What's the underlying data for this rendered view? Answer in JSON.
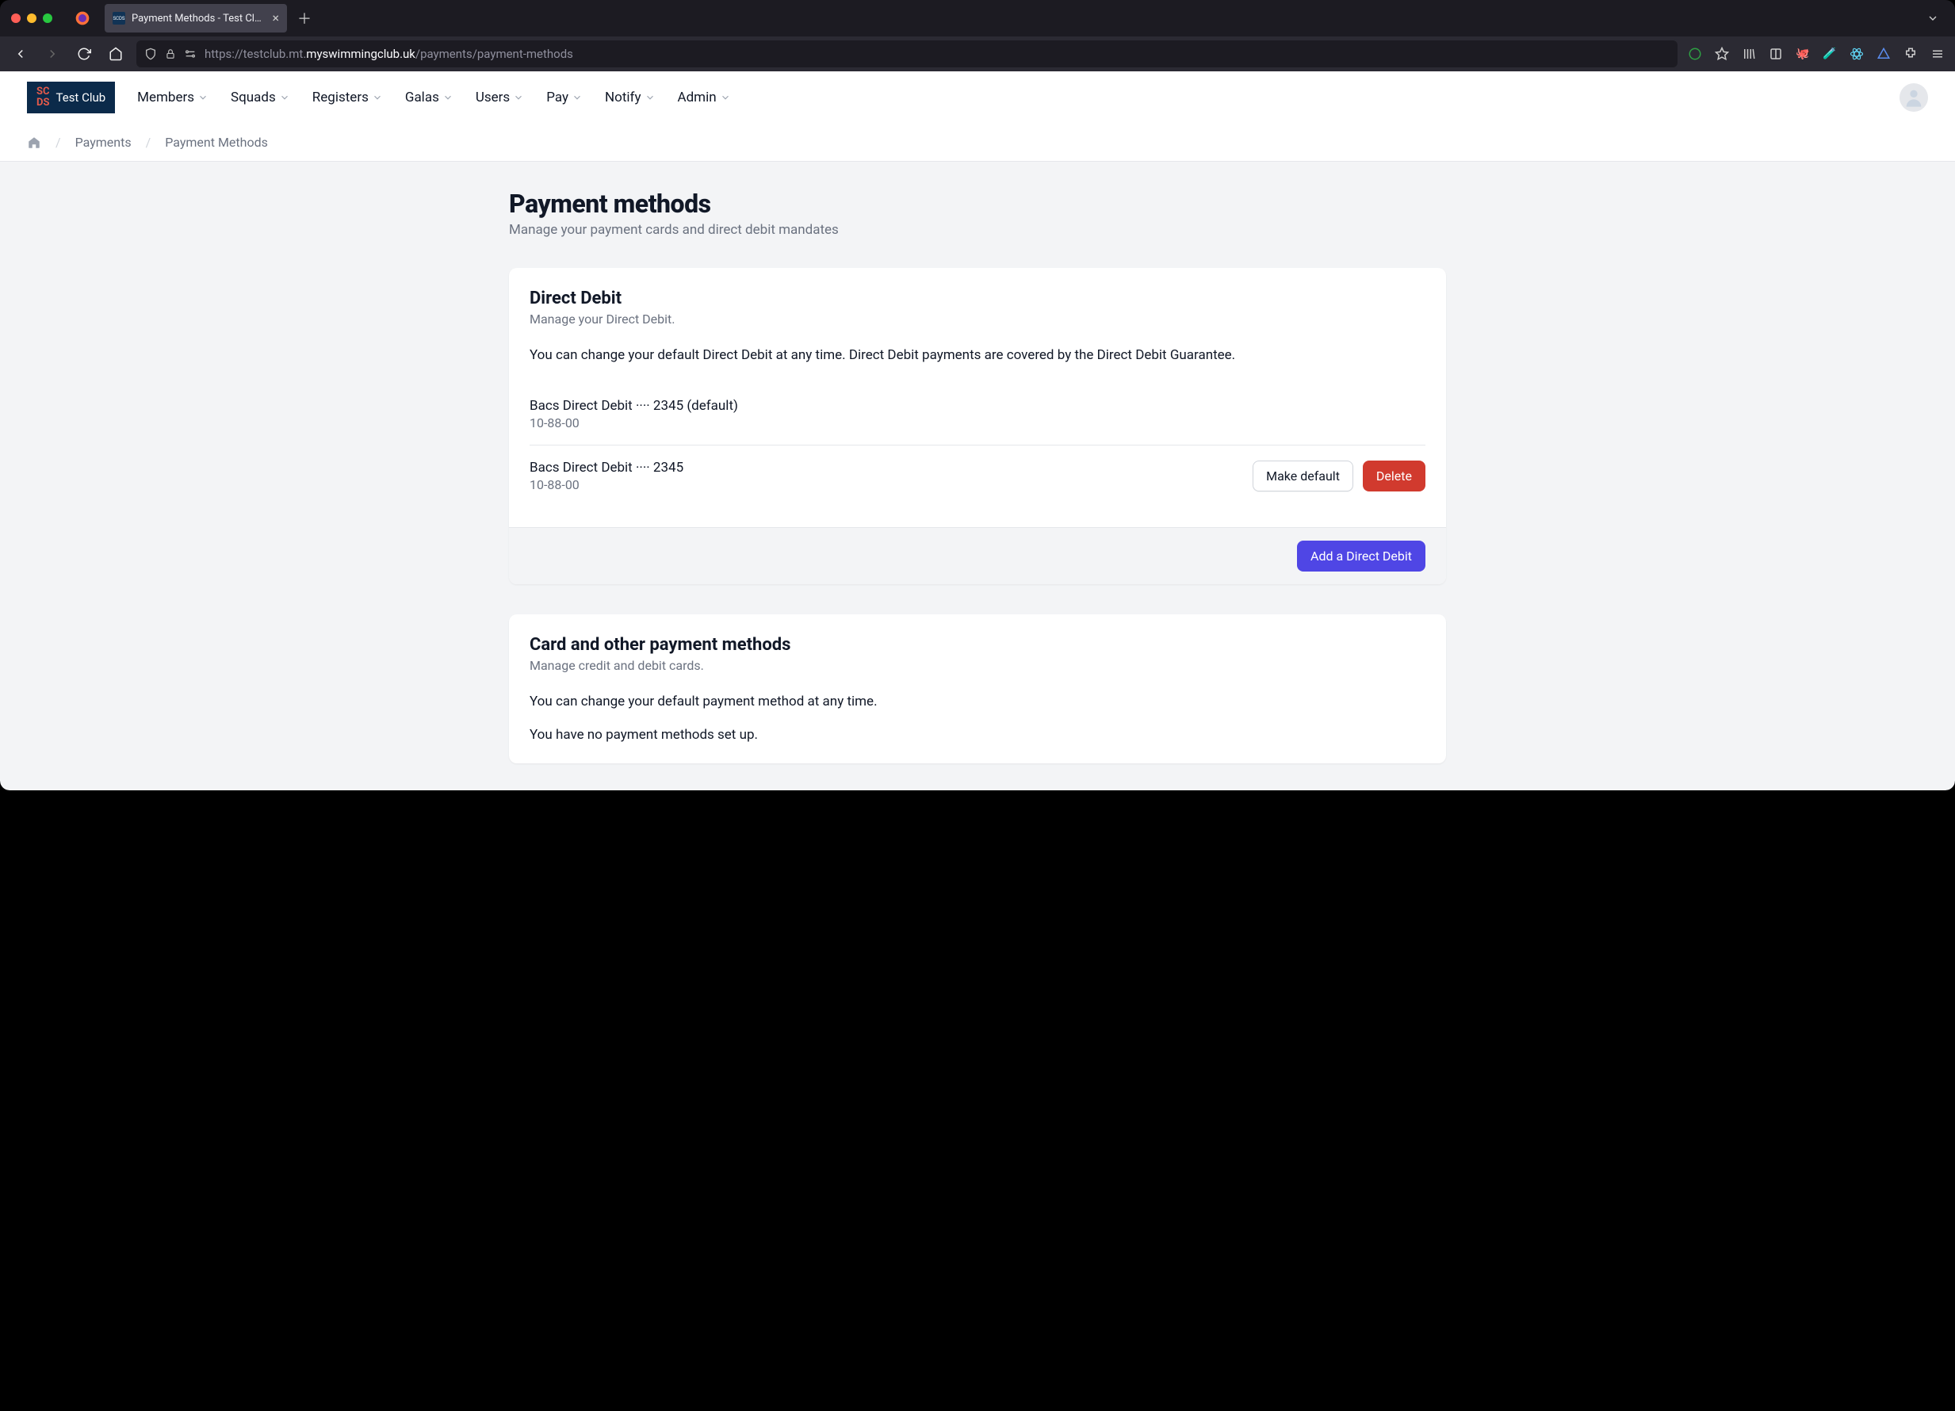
{
  "browser": {
    "tab_title": "Payment Methods - Test Club M",
    "url_prefix": "https://testclub.mt.",
    "url_domain": "myswimmingclub.uk",
    "url_path": "/payments/payment-methods"
  },
  "brand": {
    "name": "Test Club"
  },
  "nav": {
    "items": [
      {
        "label": "Members"
      },
      {
        "label": "Squads"
      },
      {
        "label": "Registers"
      },
      {
        "label": "Galas"
      },
      {
        "label": "Users"
      },
      {
        "label": "Pay"
      },
      {
        "label": "Notify"
      },
      {
        "label": "Admin"
      }
    ]
  },
  "breadcrumbs": {
    "items": [
      {
        "label": "Payments"
      },
      {
        "label": "Payment Methods"
      }
    ]
  },
  "page": {
    "title": "Payment methods",
    "subtitle": "Manage your payment cards and direct debit mandates"
  },
  "direct_debit": {
    "title": "Direct Debit",
    "subtitle": "Manage your Direct Debit.",
    "description": "You can change your default Direct Debit at any time. Direct Debit payments are covered by the Direct Debit Guarantee.",
    "items": [
      {
        "title": "Bacs Direct Debit ···· 2345 (default)",
        "sortcode": "10-88-00",
        "default": true
      },
      {
        "title": "Bacs Direct Debit ···· 2345",
        "sortcode": "10-88-00",
        "default": false
      }
    ],
    "make_default_label": "Make default",
    "delete_label": "Delete",
    "add_label": "Add a Direct Debit"
  },
  "cards": {
    "title": "Card and other payment methods",
    "subtitle": "Manage credit and debit cards.",
    "description": "You can change your default payment method at any time.",
    "empty": "You have no payment methods set up."
  }
}
